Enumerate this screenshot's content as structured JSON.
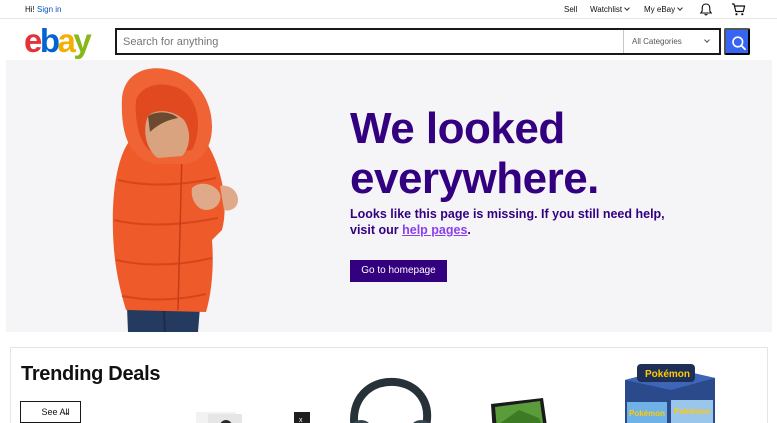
{
  "topbar": {
    "greeting": "Hi!",
    "sign_in": "Sign in",
    "sell": "Sell",
    "watchlist": "Watchlist",
    "my_ebay": "My eBay",
    "icons": [
      "bell-icon",
      "cart-icon"
    ]
  },
  "header": {
    "logo": "ebay",
    "search": {
      "placeholder": "Search for anything",
      "value": ""
    },
    "category": "All Categories",
    "search_button_icon": "search-icon"
  },
  "hero": {
    "headline_line1": "We looked",
    "headline_line2": "everywhere.",
    "sub_text": "Looks like this page is missing. If you still need help, visit our",
    "help_link": "help pages",
    "sub_end": ".",
    "button": "Go to homepage"
  },
  "trending": {
    "title": "Trending Deals",
    "see_all": "See All",
    "products": [
      "game-console",
      "headphones",
      "monitor",
      "trading-cards"
    ]
  },
  "colors": {
    "brand_purple": "#330080",
    "link_purple": "#8b3ff0",
    "search_blue": "#3665f3",
    "logo_red": "#e53238",
    "logo_blue": "#0064d2",
    "logo_yellow": "#f5af02",
    "logo_green": "#86b817",
    "jacket_orange": "#ef5a2a"
  }
}
